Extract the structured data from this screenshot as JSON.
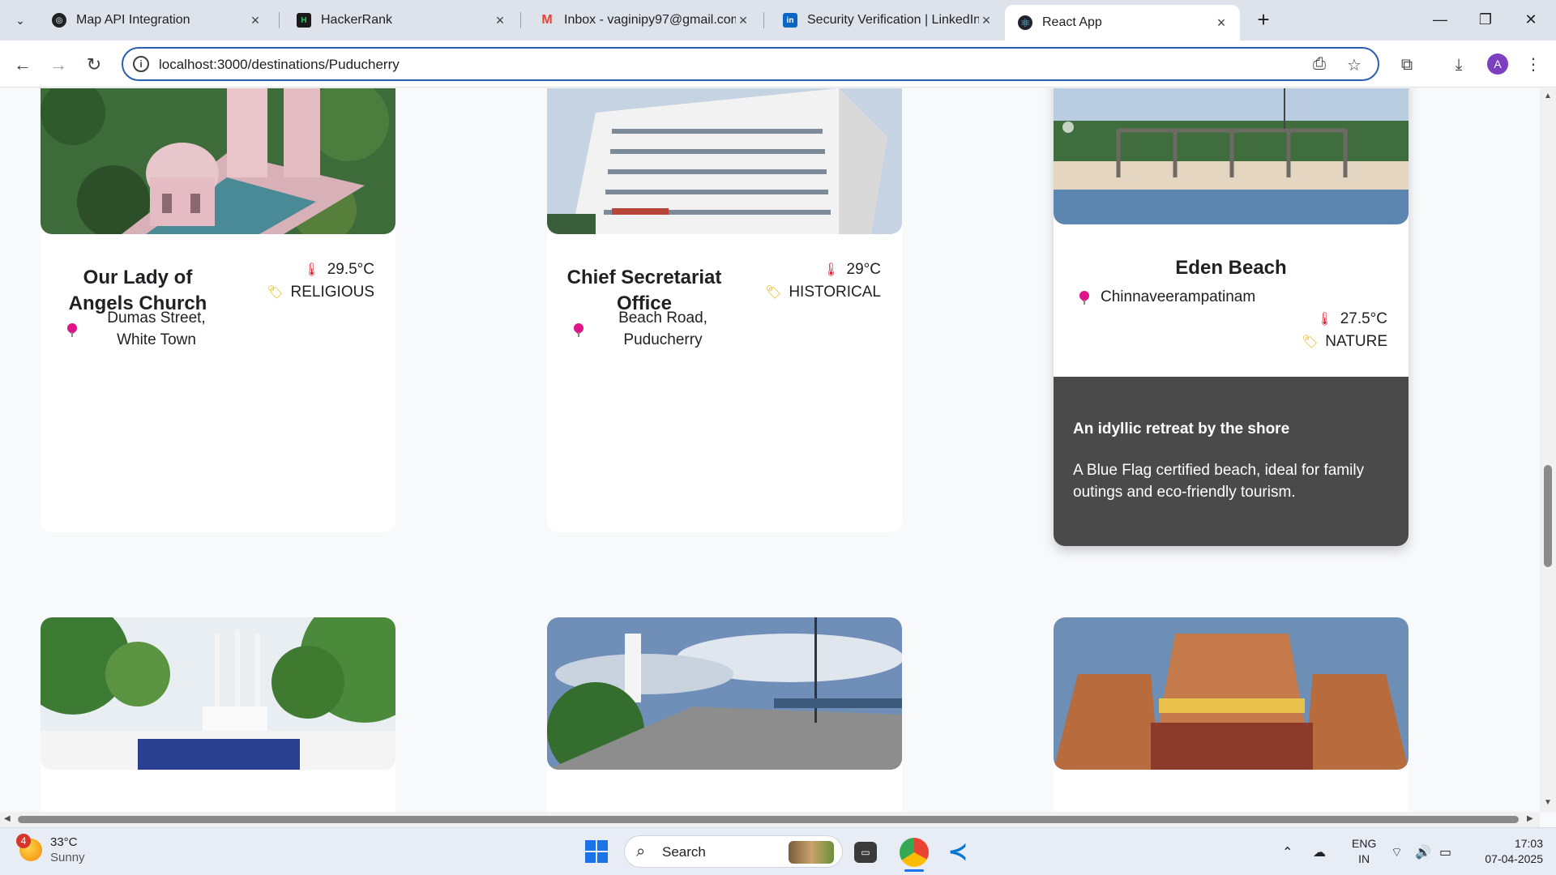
{
  "browser": {
    "tabs": [
      {
        "title": "Map API Integration",
        "active": false,
        "favicon_color": "#202124"
      },
      {
        "title": "HackerRank",
        "active": false,
        "favicon_color": "#1a1a1a"
      },
      {
        "title": "Inbox - vaginipy97@gmail.com",
        "active": false,
        "favicon_color": "#ea4335"
      },
      {
        "title": "Security Verification | LinkedIn",
        "active": false,
        "favicon_color": "#0a66c2"
      },
      {
        "title": "React App",
        "active": true,
        "favicon_color": "#61dafb"
      }
    ],
    "new_tab_glyph": "+",
    "url": "localhost:3000/destinations/Puducherry",
    "profile_initial": "A"
  },
  "cards": [
    {
      "name": "Our Lady of Angels Church",
      "temperature": "29.5°C",
      "category": "RELIGIOUS",
      "location": "Dumas Street, White Town"
    },
    {
      "name": "Chief Secretariat Office",
      "temperature": "29°C",
      "category": "HISTORICAL",
      "location": "Beach Road, Puducherry"
    },
    {
      "name": "Eden Beach",
      "location": "Chinnaveerampatinam",
      "temperature": "27.5°C",
      "category": "NATURE",
      "tagline": "An idyllic retreat by the shore",
      "description": "A Blue Flag certified beach, ideal for family outings and eco-friendly tourism."
    }
  ],
  "taskbar": {
    "weather_temp": "33°C",
    "weather_text": "Sunny",
    "notification_count": "4",
    "search_label": "Search",
    "lang_1": "ENG",
    "lang_2": "IN",
    "time": "17:03",
    "date": "07-04-2025"
  },
  "colors": {
    "omnibox_border": "#2b5fb4",
    "card_dark_panel": "#4a4a4a",
    "pin": "#e0138a"
  }
}
